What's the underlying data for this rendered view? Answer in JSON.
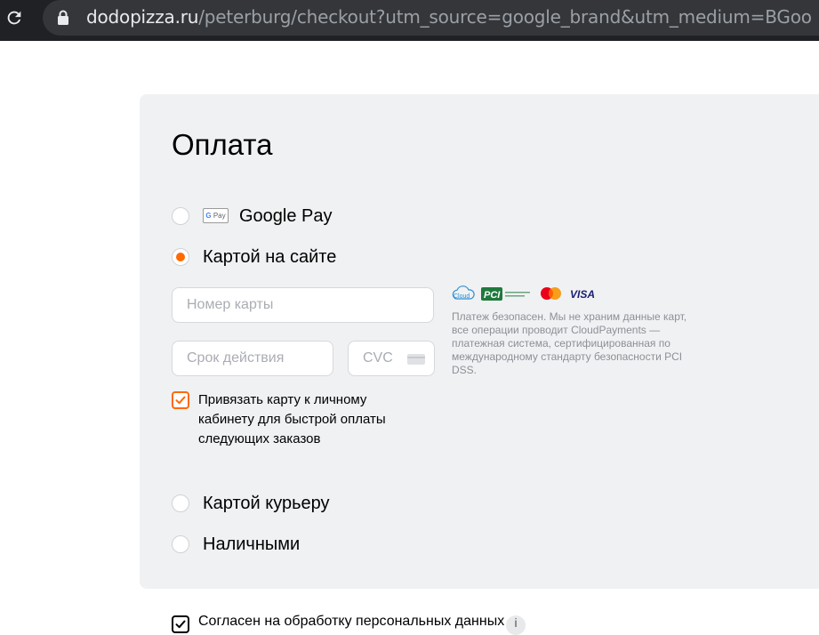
{
  "browser": {
    "url_host": "dodopizza.ru",
    "url_path": "/peterburg/checkout?utm_source=google_brand&utm_medium=BGoo"
  },
  "payment": {
    "title": "Оплата",
    "options": [
      {
        "label": "Google Pay",
        "badge": "G Pay",
        "selected": false
      },
      {
        "label": "Картой на сайте",
        "selected": true
      },
      {
        "label": "Картой курьеру",
        "selected": false
      },
      {
        "label": "Наличными",
        "selected": false
      }
    ],
    "card_form": {
      "card_number_placeholder": "Номер карты",
      "expiry_placeholder": "Срок действия",
      "cvc_placeholder": "CVC",
      "bind_card_label": "Привязать карту к личному кабинету для быстрой оплаты следующих заказов",
      "bind_card_checked": true
    },
    "security_logos": [
      "cloudpayments-logo",
      "pci-dss-logo",
      "mastercard-logo",
      "visa-logo"
    ],
    "logo_text": {
      "cloud": "Cloud",
      "pci": "PCI",
      "visa": "VISA"
    },
    "security_note": "Платеж безопасен. Мы не храним данные карт, все операции проводит CloudPayments — платежная система, сертифицированная по международному стандарту безопасности PCI DSS."
  },
  "consent": {
    "label": "Согласен на обработку персональных данных",
    "checked": true,
    "info": "i"
  },
  "colors": {
    "accent": "#ff6900",
    "panel_bg": "#f0f1f3",
    "browser_bg": "#202124"
  }
}
